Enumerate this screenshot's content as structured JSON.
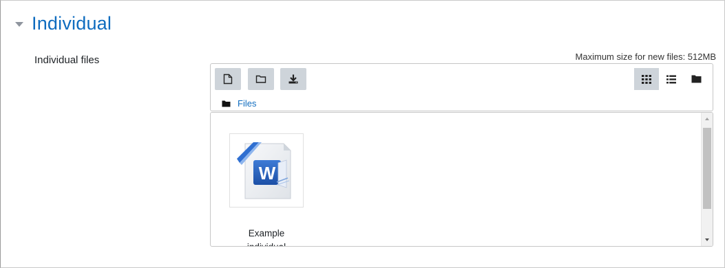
{
  "section": {
    "title": "Individual",
    "toggle_icon": "caret-down-icon"
  },
  "field": {
    "label": "Individual files",
    "max_size_text": "Maximum size for new files: 512MB"
  },
  "toolbar": {
    "buttons": [
      {
        "name": "add-file",
        "icon": "file-icon"
      },
      {
        "name": "create-folder",
        "icon": "folder-icon"
      },
      {
        "name": "download-all",
        "icon": "download-icon"
      }
    ],
    "views": [
      {
        "name": "icons-view",
        "icon": "grid-icon",
        "active": true
      },
      {
        "name": "list-view",
        "icon": "list-icon",
        "active": false
      },
      {
        "name": "tree-view",
        "icon": "folder-icon",
        "active": false
      }
    ]
  },
  "path": {
    "icon": "folder-icon",
    "label": "Files"
  },
  "files": [
    {
      "name": "Example individual",
      "icon": "word-document-icon"
    }
  ],
  "colors": {
    "accent": "#0f6cbf",
    "button_bg": "#ced4da",
    "border": "#c6c6c6"
  }
}
